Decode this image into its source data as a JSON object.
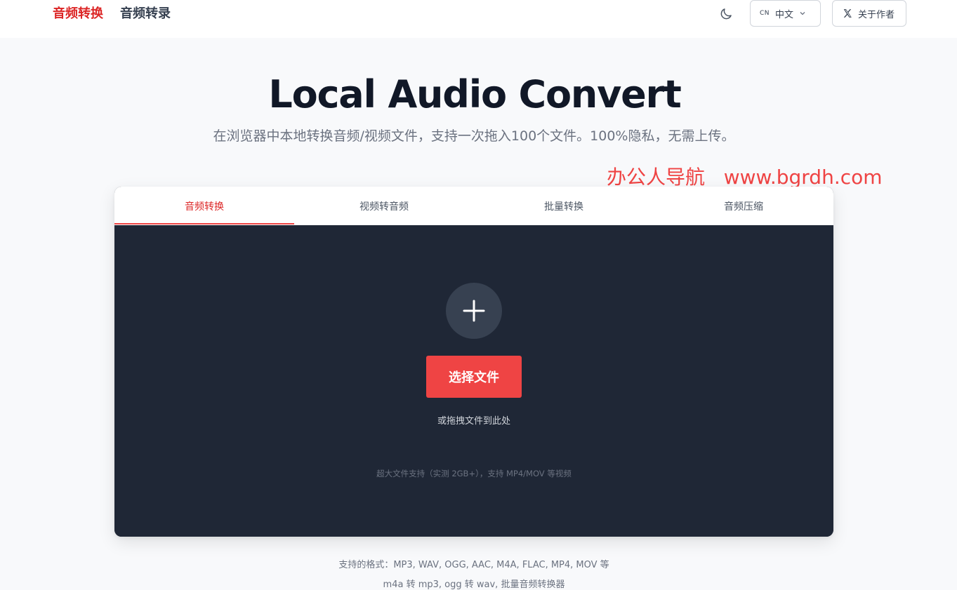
{
  "nav": {
    "primary": "音频转换",
    "secondary": "音频转录"
  },
  "header": {
    "theme_icon": "moon-icon",
    "lang_code": "CN",
    "lang_label": "中文",
    "about_label": "关于作者",
    "about_icon": "x-logo-icon"
  },
  "hero": {
    "title": "Local Audio Convert",
    "subtitle": "在浏览器中本地转换音频/视频文件，支持一次拖入100个文件。100%隐私，无需上传。"
  },
  "watermark": "办公人导航   www.bgrdh.com",
  "tabs": [
    {
      "label": "音频转换",
      "active": true
    },
    {
      "label": "视频转音频",
      "active": false
    },
    {
      "label": "批量转换",
      "active": false
    },
    {
      "label": "音频压缩",
      "active": false
    }
  ],
  "upload": {
    "plus_icon": "plus-icon",
    "button_label": "选择文件",
    "drag_hint": "或拖拽文件到此处",
    "size_hint": "超大文件支持（实测 2GB+），支持 MP4/MOV 等视频"
  },
  "footer": {
    "formats": "支持的格式：MP3, WAV, OGG, AAC, M4A, FLAC, MP4, MOV 等",
    "keywords": "m4a 转 mp3, ogg 转 wav, 批量音频转换器"
  },
  "colors": {
    "accent": "#ef4444",
    "accent_text": "#dc2626",
    "dropzone_bg": "#1f2736",
    "page_bg": "#f8f9fb"
  }
}
